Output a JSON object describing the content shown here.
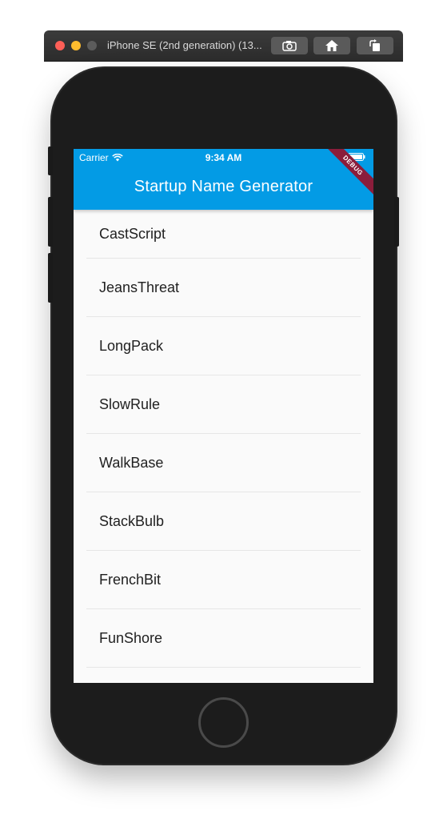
{
  "simulator": {
    "title": "iPhone SE (2nd generation) (13...",
    "buttons": [
      {
        "icon": "screenshot-icon"
      },
      {
        "icon": "home-icon"
      },
      {
        "icon": "rotate-icon"
      }
    ]
  },
  "status_bar": {
    "carrier": "Carrier",
    "time": "9:34 AM"
  },
  "app_bar": {
    "title": "Startup Name Generator",
    "color": "#039be5"
  },
  "debug_banner": "DEBUG",
  "list": {
    "items": [
      "CastScript",
      "JeansThreat",
      "LongPack",
      "SlowRule",
      "WalkBase",
      "StackBulb",
      "FrenchBit",
      "FunShore"
    ]
  }
}
